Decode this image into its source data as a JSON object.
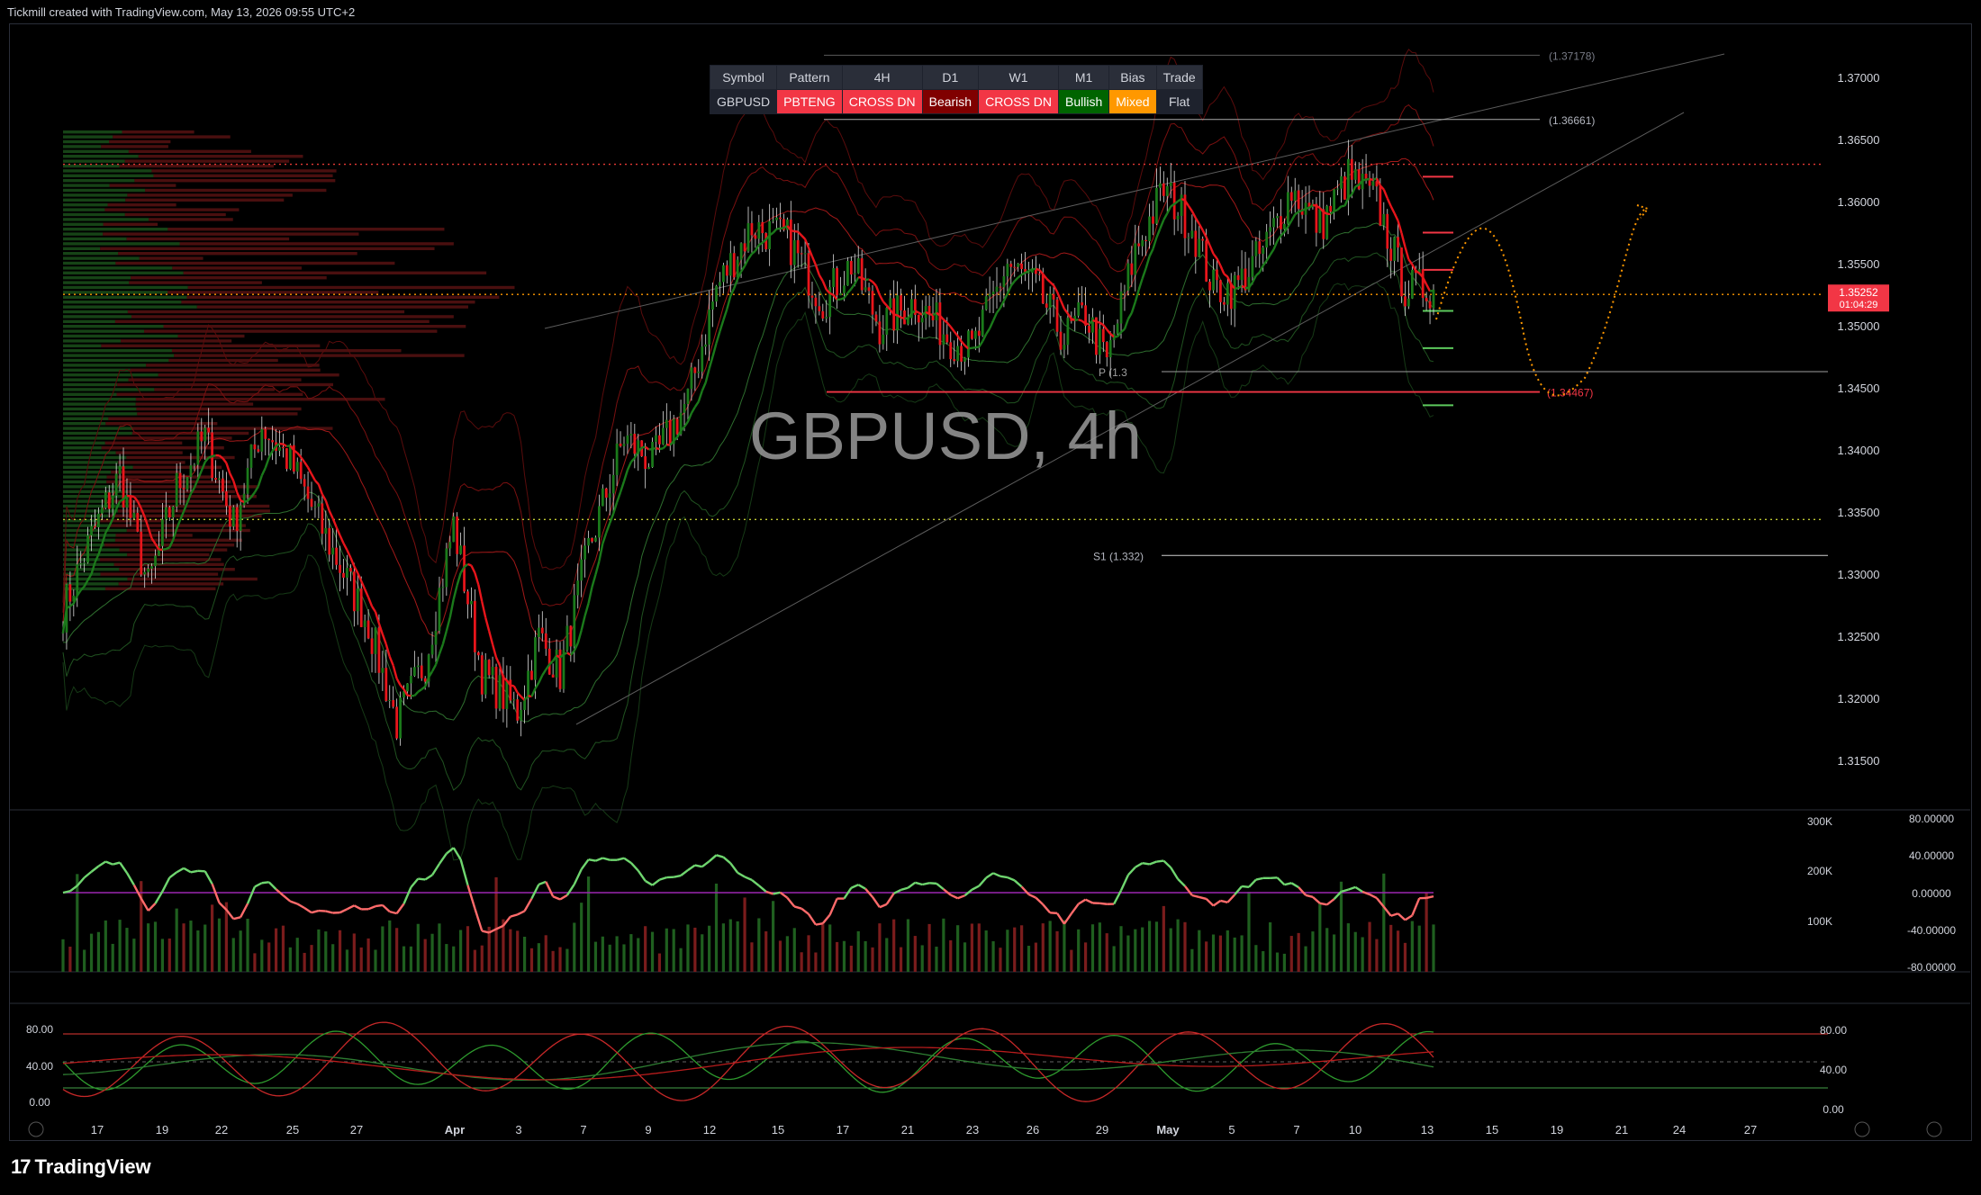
{
  "header": {
    "credit": "Tickmill created with TradingView.com, May 13, 2026 09:55 UTC+2"
  },
  "brand": {
    "name": "TradingView"
  },
  "watermark": "GBPUSD, 4h",
  "summary_table": {
    "headers": [
      "Symbol",
      "Pattern",
      "4H",
      "D1",
      "W1",
      "M1",
      "Bias",
      "Trade"
    ],
    "values": [
      "GBPUSD",
      "PBTENG",
      "CROSS DN",
      "Bearish",
      "CROSS DN",
      "Bullish",
      "Mixed",
      "Flat"
    ]
  },
  "levels": {
    "top_label": "(1.37178)",
    "upper_label": "(1.36661)",
    "low_label": "(1.34467)",
    "pivot_label": "P (1.3",
    "s1_label": "S1 (1.332)"
  },
  "price_badge": {
    "price": "1.35252",
    "timer": "01:04:29"
  },
  "colors": {
    "bull": "#1b7a1b",
    "bear": "#e8151b",
    "up_osc": "#6fd66f",
    "down_osc": "#ff6b6b",
    "accent": "#f23645"
  },
  "chart_data": [
    {
      "type": "candlestick",
      "title": "GBPUSD, 4h",
      "y_ticks": [
        "1.37000",
        "1.36500",
        "1.36000",
        "1.35500",
        "1.35000",
        "1.34500",
        "1.34000",
        "1.33500",
        "1.33000",
        "1.32500",
        "1.32000",
        "1.31500"
      ],
      "ylim": [
        1.311,
        1.372
      ],
      "x_ticks": [
        "17",
        "19",
        "22",
        "25",
        "27",
        "Apr",
        "3",
        "7",
        "9",
        "12",
        "15",
        "17",
        "21",
        "23",
        "26",
        "29",
        "May",
        "5",
        "7",
        "10",
        "13",
        "15",
        "19",
        "21",
        "24",
        "27"
      ],
      "reference_lines": [
        {
          "price": 1.37178,
          "label": "(1.37178)"
        },
        {
          "price": 1.36661,
          "label": "(1.36661)"
        },
        {
          "price": 1.363,
          "label": "",
          "style": "dotted-red"
        },
        {
          "price": 1.35252,
          "label": "1.35252",
          "style": "dotted-orange"
        },
        {
          "price": 1.3463,
          "label": "P (1.3"
        },
        {
          "price": 1.34467,
          "label": "(1.34467)"
        },
        {
          "price": 1.3344,
          "label": "",
          "style": "dotted-olive"
        },
        {
          "price": 1.3315,
          "label": "S1 (1.332)"
        }
      ],
      "waypoints": [
        [
          0,
          1.327
        ],
        [
          8,
          1.333
        ],
        [
          16,
          1.338
        ],
        [
          24,
          1.329
        ],
        [
          32,
          1.337
        ],
        [
          40,
          1.341
        ],
        [
          48,
          1.334
        ],
        [
          56,
          1.342
        ],
        [
          64,
          1.339
        ],
        [
          74,
          1.333
        ],
        [
          86,
          1.326
        ],
        [
          94,
          1.318
        ],
        [
          102,
          1.323
        ],
        [
          110,
          1.334
        ],
        [
          118,
          1.322
        ],
        [
          128,
          1.319
        ],
        [
          134,
          1.325
        ],
        [
          140,
          1.322
        ],
        [
          148,
          1.332
        ],
        [
          158,
          1.341
        ],
        [
          166,
          1.339
        ],
        [
          176,
          1.344
        ],
        [
          184,
          1.353
        ],
        [
          194,
          1.358
        ],
        [
          204,
          1.357
        ],
        [
          214,
          1.352
        ],
        [
          222,
          1.355
        ],
        [
          230,
          1.35
        ],
        [
          240,
          1.352
        ],
        [
          250,
          1.349
        ],
        [
          256,
          1.348
        ],
        [
          266,
          1.355
        ],
        [
          274,
          1.353
        ],
        [
          282,
          1.349
        ],
        [
          288,
          1.351
        ],
        [
          294,
          1.347
        ],
        [
          302,
          1.356
        ],
        [
          310,
          1.361
        ],
        [
          318,
          1.358
        ],
        [
          324,
          1.353
        ],
        [
          330,
          1.353
        ],
        [
          338,
          1.356
        ],
        [
          346,
          1.361
        ],
        [
          354,
          1.358
        ],
        [
          362,
          1.362
        ],
        [
          370,
          1.36
        ],
        [
          378,
          1.353
        ],
        [
          386,
          1.353
        ]
      ]
    },
    {
      "type": "line+bar",
      "title": "",
      "y_ticks_left": [
        "300K",
        "200K",
        "100K"
      ],
      "y_ticks_right": [
        "80.00000",
        "40.00000",
        "0.00000",
        "-40.00000",
        "-80.00000"
      ]
    },
    {
      "type": "line",
      "title": "",
      "y_ticks_left": [
        "80.00",
        "40.00",
        "0.00"
      ],
      "y_ticks_right": [
        "80.00",
        "40.00",
        "0.00"
      ]
    }
  ]
}
